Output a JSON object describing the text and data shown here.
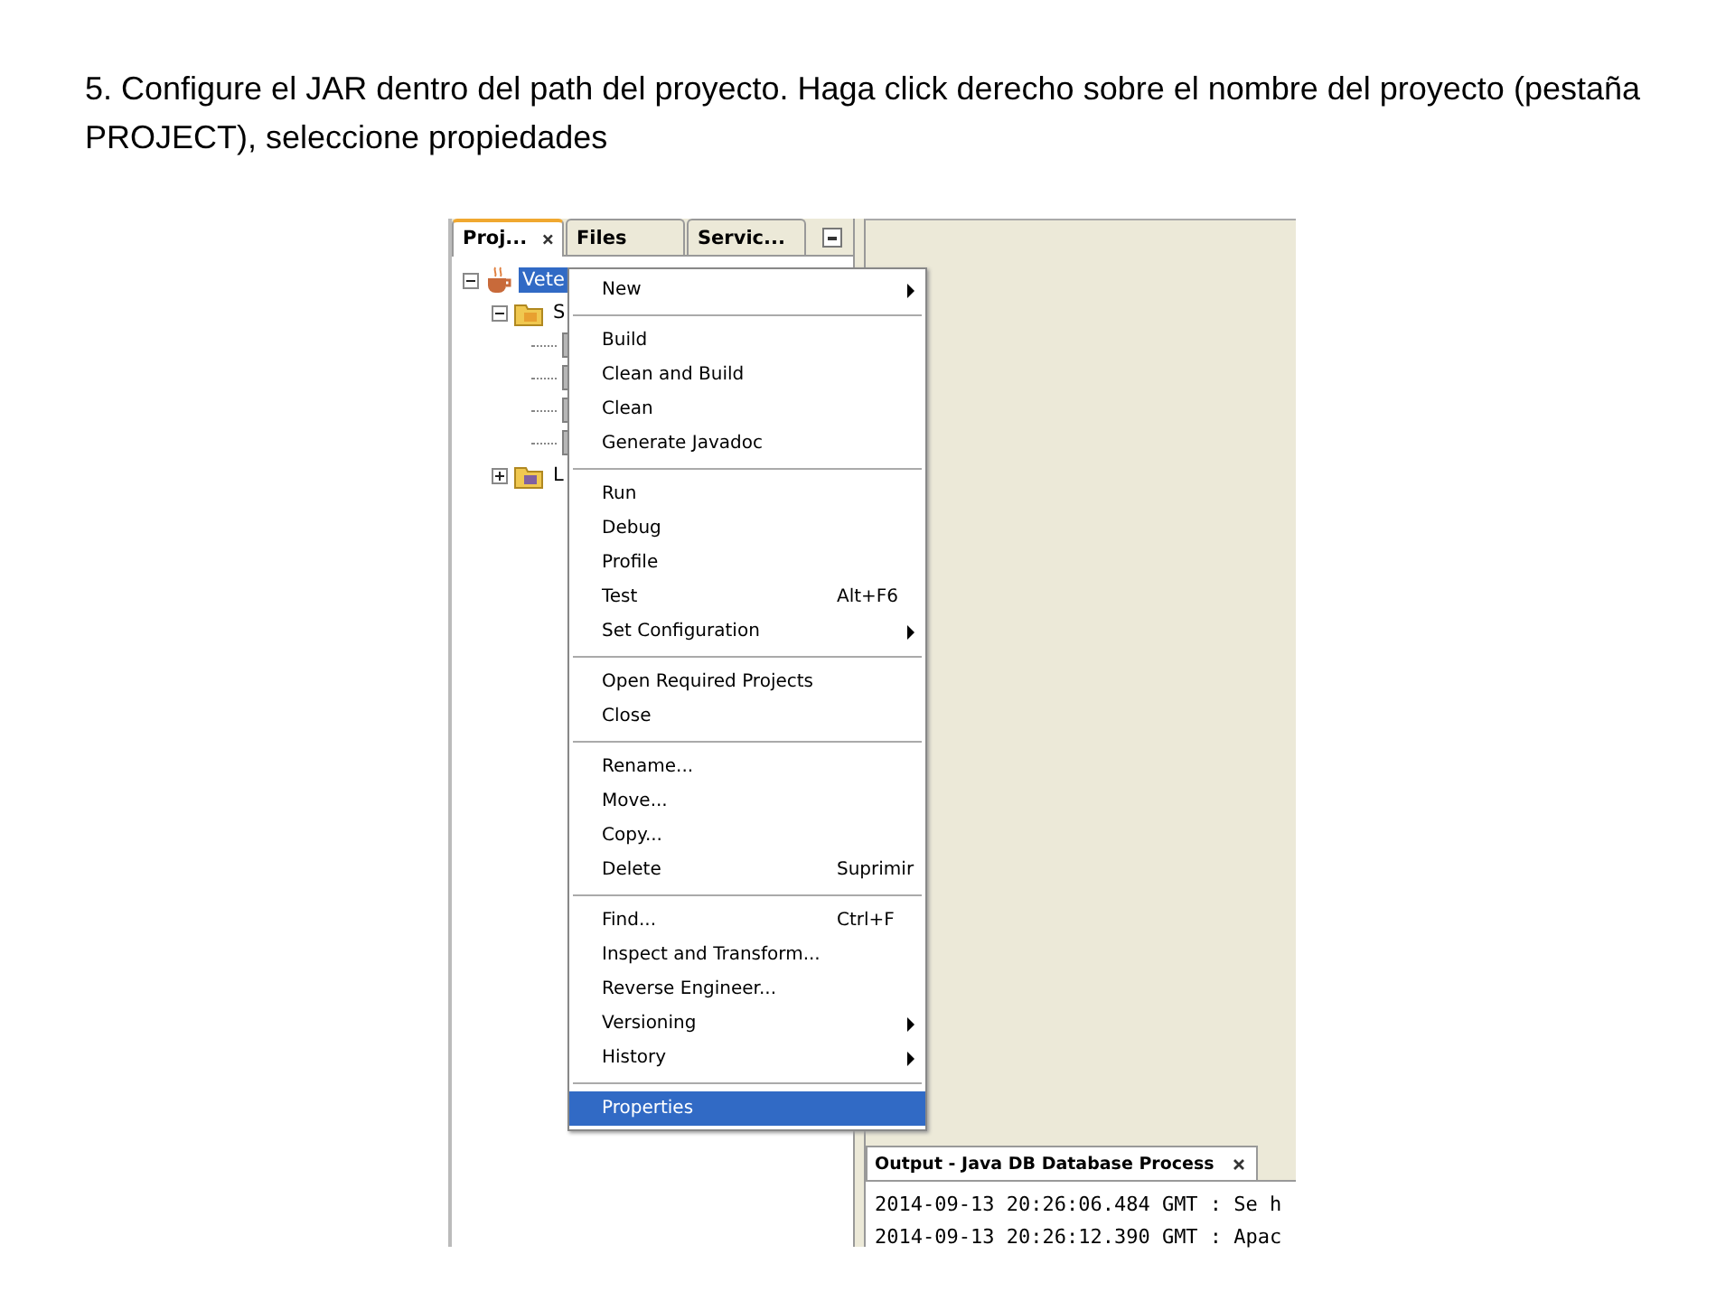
{
  "caption": "5. Configure el JAR dentro del path del proyecto. Haga click derecho sobre el nombre del proyecto (pestaña PROJECT), seleccione propiedades",
  "tabs": [
    {
      "label": "Proj...",
      "selected": true,
      "closable": true
    },
    {
      "label": "Files",
      "selected": false,
      "closable": false
    },
    {
      "label": "Servic...",
      "selected": false,
      "closable": false
    }
  ],
  "tree": [
    {
      "label": "Vete",
      "kind": "project",
      "expanded": true,
      "selected": true,
      "children": [
        {
          "label": "S",
          "kind": "folder",
          "expanded": true,
          "selected": false,
          "children": [
            {
              "kind": "file"
            },
            {
              "kind": "file"
            },
            {
              "kind": "file"
            },
            {
              "kind": "file"
            }
          ]
        },
        {
          "label": "L",
          "kind": "library",
          "expanded": false,
          "selected": false
        }
      ]
    }
  ],
  "menu": [
    {
      "kind": "item",
      "label": "New",
      "submenu": true,
      "selected": false
    },
    {
      "kind": "separator"
    },
    {
      "kind": "item",
      "label": "Build",
      "selected": false
    },
    {
      "kind": "item",
      "label": "Clean and Build",
      "selected": false
    },
    {
      "kind": "item",
      "label": "Clean",
      "selected": false
    },
    {
      "kind": "item",
      "label": "Generate Javadoc",
      "selected": false
    },
    {
      "kind": "separator"
    },
    {
      "kind": "item",
      "label": "Run",
      "selected": false
    },
    {
      "kind": "item",
      "label": "Debug",
      "selected": false
    },
    {
      "kind": "item",
      "label": "Profile",
      "selected": false
    },
    {
      "kind": "item",
      "label": "Test",
      "shortcut": "Alt+F6",
      "selected": false
    },
    {
      "kind": "item",
      "label": "Set Configuration",
      "submenu": true,
      "selected": false
    },
    {
      "kind": "separator"
    },
    {
      "kind": "item",
      "label": "Open Required Projects",
      "selected": false
    },
    {
      "kind": "item",
      "label": "Close",
      "selected": false
    },
    {
      "kind": "separator"
    },
    {
      "kind": "item",
      "label": "Rename...",
      "selected": false
    },
    {
      "kind": "item",
      "label": "Move...",
      "selected": false
    },
    {
      "kind": "item",
      "label": "Copy...",
      "selected": false
    },
    {
      "kind": "item",
      "label": "Delete",
      "shortcut": "Suprimir",
      "selected": false
    },
    {
      "kind": "separator"
    },
    {
      "kind": "item",
      "label": "Find...",
      "shortcut": "Ctrl+F",
      "selected": false
    },
    {
      "kind": "item",
      "label": "Inspect and Transform...",
      "selected": false
    },
    {
      "kind": "item",
      "label": "Reverse Engineer...",
      "selected": false
    },
    {
      "kind": "item",
      "label": "Versioning",
      "submenu": true,
      "selected": false
    },
    {
      "kind": "item",
      "label": "History",
      "submenu": true,
      "selected": false
    },
    {
      "kind": "separator"
    },
    {
      "kind": "item",
      "label": "Properties",
      "selected": true
    }
  ],
  "output": {
    "tab": "Output - Java DB Database Process",
    "lines": [
      "2014-09-13 20:26:06.484 GMT : Se h",
      "2014-09-13 20:26:12.390 GMT : Apac"
    ]
  }
}
